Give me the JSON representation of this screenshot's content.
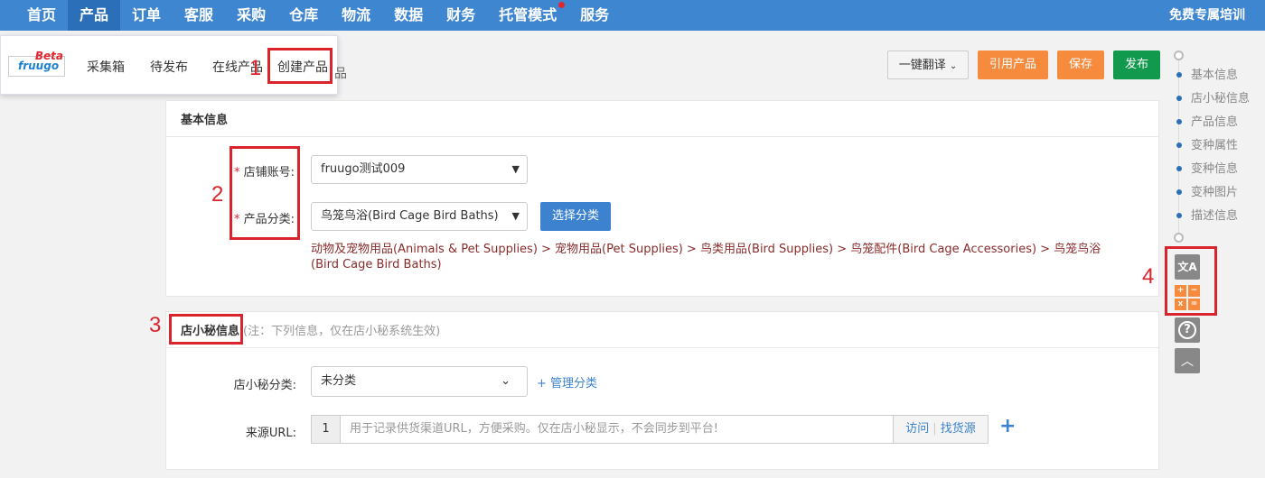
{
  "nav": {
    "items": [
      "首页",
      "产品",
      "订单",
      "客服",
      "采购",
      "仓库",
      "物流",
      "数据",
      "财务",
      "托管模式",
      "服务"
    ],
    "active_index": 1,
    "dot_item": "托管模式",
    "training_label": "免费专属培训"
  },
  "submenu": {
    "logo_text": "fruugo",
    "beta_label": "Beta",
    "items": [
      "采集箱",
      "待发布",
      "在线产品",
      "创建产品"
    ]
  },
  "behind_text": "品",
  "annotations": [
    "1",
    "2",
    "3",
    "4"
  ],
  "actions": {
    "translate_label": "一键翻译",
    "cite_label": "引用产品",
    "save_label": "保存",
    "publish_label": "发布"
  },
  "basic_info": {
    "title": "基本信息",
    "store_label": "店铺账号:",
    "store_value": "fruugo测试009",
    "category_label": "产品分类:",
    "category_value": "鸟笼鸟浴(Bird Cage Bird Baths)",
    "select_category_label": "选择分类",
    "category_path": "动物及宠物用品(Animals & Pet Supplies) > 宠物用品(Pet Supplies) > 鸟类用品(Bird Supplies) > 鸟笼配件(Bird Cage Accessories) > 鸟笼鸟浴(Bird Cage Bird Baths)",
    "required_mark": "*"
  },
  "secret_info": {
    "title": "店小秘信息",
    "note": "(注：下列信息，仅在店小秘系统生效)",
    "category_label": "店小秘分类:",
    "category_value": "未分类",
    "manage_label": "+ 管理分类",
    "url_label": "来源URL:",
    "url_index": "1",
    "url_placeholder": "用于记录供货渠道URL，方便采购。仅在店小秘显示，不会同步到平台!",
    "visit_label": "访问",
    "find_label": "找货源",
    "add_symbol": "+"
  },
  "side_nav": {
    "items": [
      "基本信息",
      "店小秘信息",
      "产品信息",
      "变种属性",
      "变种信息",
      "变种图片",
      "描述信息"
    ]
  },
  "tools": {
    "translate_glyph": "文A",
    "calc_glyphs": [
      "+",
      "−",
      "x",
      "="
    ],
    "help_glyph": "?",
    "top_glyph": "︿"
  },
  "colors": {
    "nav_bg": "#3f86d1",
    "annotation_red": "#d9232d",
    "orange_button": "#f68b3e",
    "green_button": "#119a4e",
    "blue_button": "#3c82ce",
    "breadcrumb_text": "#8a2b2b"
  }
}
